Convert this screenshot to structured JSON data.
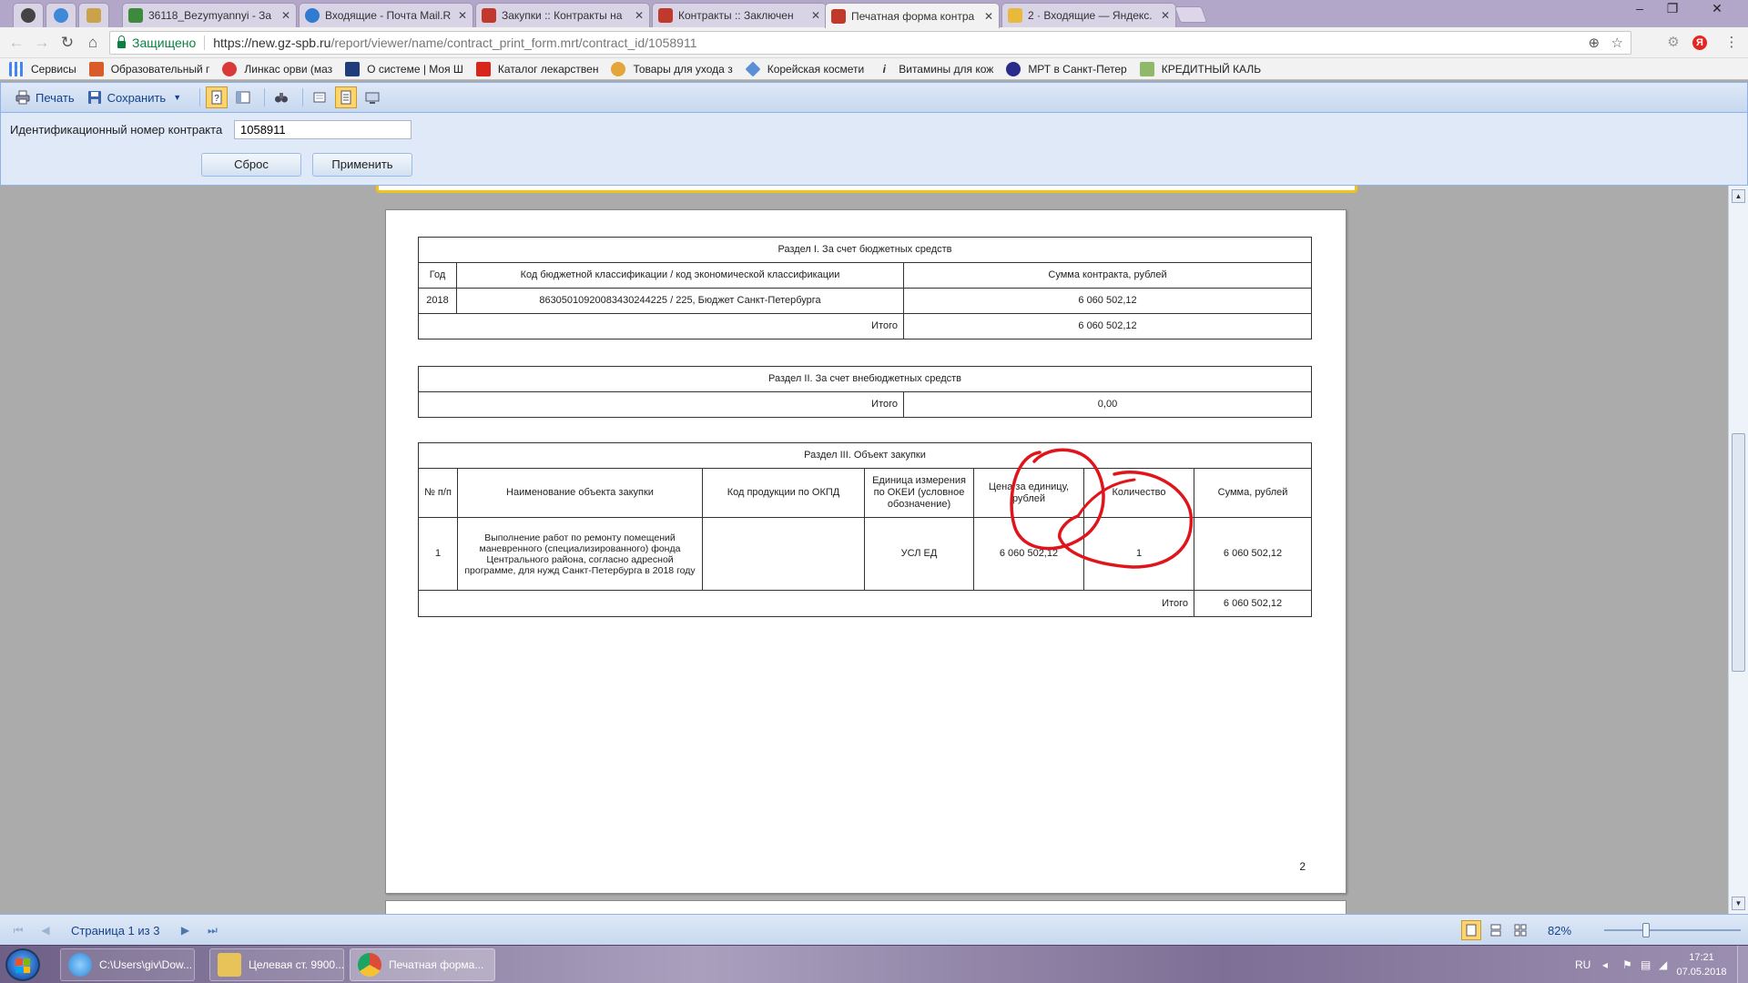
{
  "browser": {
    "tabs": [
      {
        "title": "",
        "color": "#444444"
      },
      {
        "title": "",
        "color": "#3f8ad8"
      },
      {
        "title": "",
        "color": "#c9a24a"
      },
      {
        "title": "36118_Bezymyannyi - За",
        "color": "#3c8a3c"
      },
      {
        "title": "Входящие - Почта Mail.R",
        "color": "#2e7bd1"
      },
      {
        "title": "Закупки :: Контракты на",
        "color": "#c0392b"
      },
      {
        "title": "Контракты :: Заключен",
        "color": "#c0392b"
      },
      {
        "title": "Печатная форма контра",
        "color": "#c0392b"
      },
      {
        "title": "2 · Входящие — Яндекс.",
        "color": "#e8b93a"
      }
    ],
    "secure_label": "Защищено",
    "url_host": "https://new.gz-spb.ru",
    "url_path": "/report/viewer/name/contract_print_form.mrt/contract_id/1058911",
    "bookmarks": [
      {
        "label": "Сервисы",
        "color": "#4285f4"
      },
      {
        "label": "Образовательный г",
        "color": "#d95b2b"
      },
      {
        "label": "Линкас орви (маз",
        "color": "#d83a3a"
      },
      {
        "label": "О системе | Моя Ш",
        "color": "#1e3d7a"
      },
      {
        "label": "Каталог лекарствен",
        "color": "#d9261c"
      },
      {
        "label": "Товары для ухода з",
        "color": "#e4a53a"
      },
      {
        "label": "Корейская космети",
        "color": "#5a8fd8"
      },
      {
        "label": "Витамины для кож",
        "color": "#333333"
      },
      {
        "label": "МРТ в Санкт-Петер",
        "color": "#2a2a8a"
      },
      {
        "label": "КРЕДИТНЫЙ КАЛЬ",
        "color": "#8fb86a"
      }
    ]
  },
  "viewer": {
    "print_label": "Печать",
    "save_label": "Сохранить",
    "param_label": "Идентификационный номер контракта",
    "param_value": "1058911",
    "reset_label": "Сброс",
    "apply_label": "Применить",
    "page_status": "Страница 1 из 3",
    "zoom": "82%"
  },
  "report": {
    "section1": {
      "title": "Раздел I. За счет бюджетных средств",
      "headers": [
        "Год",
        "Код бюджетной классификации / код экономической классификации",
        "Сумма контракта, рублей"
      ],
      "row": [
        "2018",
        "86305010920083430244225 / 225, Бюджет Санкт-Петербурга",
        "6 060 502,12"
      ],
      "total_label": "Итого",
      "total_value": "6 060 502,12"
    },
    "section2": {
      "title": "Раздел II. За счет внебюджетных средств",
      "total_label": "Итого",
      "total_value": "0,00"
    },
    "section3": {
      "title": "Раздел III. Объект закупки",
      "headers": [
        "№ п/п",
        "Наименование объекта закупки",
        "Код продукции по ОКПД",
        "Единица измерения по ОКЕИ (условное обозначение)",
        "Цена за единицу, рублей",
        "Количество",
        "Сумма, рублей"
      ],
      "row": [
        "1",
        "Выполнение работ по ремонту помещений маневренного (специализированного) фонда Центрального района, согласно адресной программе, для нужд Санкт-Петербурга в 2018 году",
        "",
        "УСЛ ЕД",
        "6 060 502,12",
        "1",
        "6 060 502,12"
      ],
      "total_label": "Итого",
      "total_value": "6 060 502,12"
    },
    "page_number": "2"
  },
  "taskbar": {
    "items": [
      {
        "label": "C:\\Users\\giv\\Dow...",
        "color": "#2f86d6"
      },
      {
        "label": "Целевая ст. 9900...",
        "color": "#e8c35a"
      },
      {
        "label": "Печатная форма...",
        "color": "#dd4b39"
      }
    ],
    "lang": "RU",
    "time": "17:21",
    "date": "07.05.2018"
  },
  "colors": {
    "annotation": "#e0141b",
    "accent": "#15428b"
  }
}
